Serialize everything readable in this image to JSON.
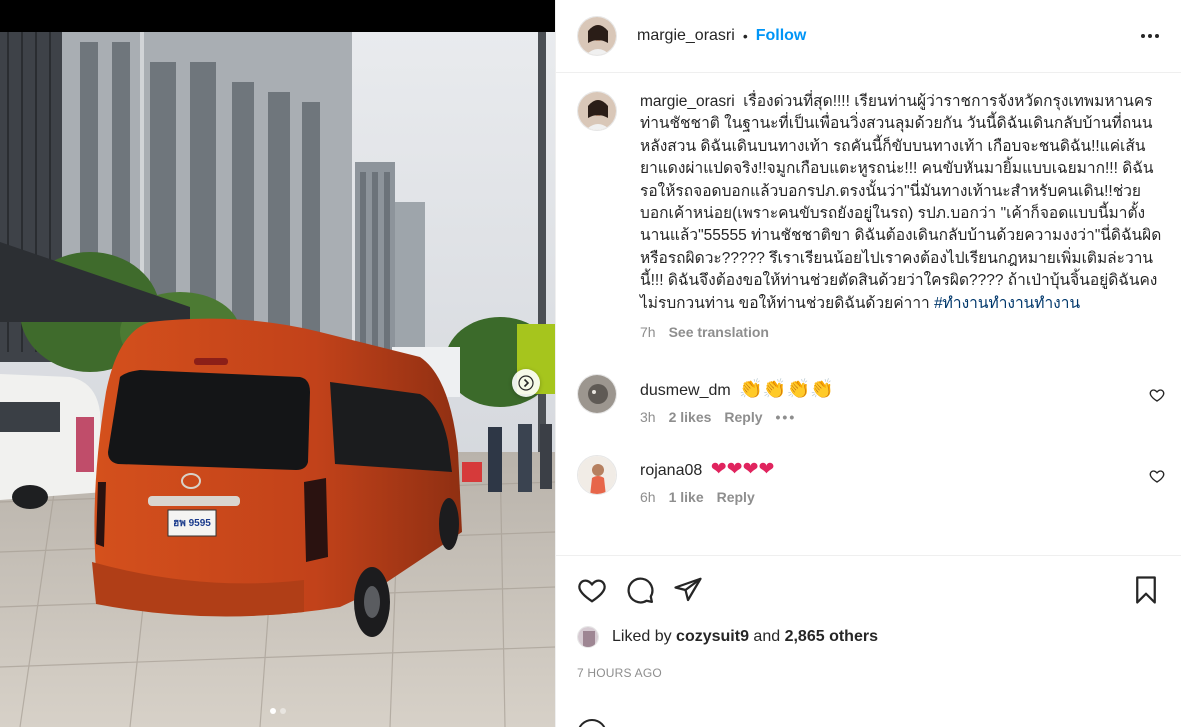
{
  "post": {
    "username": "margie_orasri",
    "separator": "•",
    "follow_label": "Follow",
    "caption": {
      "username": "margie_orasri",
      "text": "เรื่องด่วนที่สุด!!!! เรียนท่านผู้ว่าราชการจังหวัดกรุงเทพมหานคร ท่านชัชชาติ ในฐานะที่เป็นเพื่อนวิ่งสวนลุมด้วยกัน วันนี้ดิฉันเดินกลับบ้านที่ถนนหลังสวน ดิฉันเดินบนทางเท้า รถคันนี้ก็ขับบนทางเท้า เกือบจะชนดิฉัน!!แค่เส้นยาแดงผ่าแปดจริง!!จมูกเกือบแตะหูรถน่ะ!!! คนขับหันมายิ้มแบบเฉยมาก!!! ดิฉันรอให้รถจอดบอกแล้วบอกรปภ.ตรงนั้นว่า\"นี่มันทางเท้านะสำหรับคนเดิน!!ช่วยบอกเค้าหน่อย(เพราะคนขับรถยังอยู่ในรถ) รปภ.บอกว่า \"เค้าก็จอดแบบนี้มาตั้งนานแล้ว\"55555 ท่านชัชชาติขา ดิฉันต้องเดินกลับบ้านด้วยความงงว่า\"นี่ดิฉันผิดหรือรถผิดวะ????? รึเราเรียนน้อยไปเราคงต้องไปเรียนกฎหมายเพิ่มเติมล่ะวานนี้!!! ดิฉันจึงต้องขอให้ท่านช่วยตัดสินด้วยว่าใครผิด???? ถ้าเป่าบุ้นจิ้นอยู่ดิฉันคงไม่รบกวนท่าน ขอให้ท่านช่วยดิฉันด้วยค่าาา",
      "hashtag": "#ทำงานทำงานทำงาน",
      "time": "7h",
      "translate_label": "See translation"
    },
    "comments": [
      {
        "username": "dusmew_dm",
        "emoji": "👏👏👏👏",
        "time": "3h",
        "likes": "2 likes",
        "reply_label": "Reply",
        "more": "•••"
      },
      {
        "username": "rojana08",
        "emoji": "❤❤❤❤",
        "time": "6h",
        "likes": "1 like",
        "reply_label": "Reply"
      }
    ],
    "liked_by_prefix": "Liked by",
    "liked_by_user": "cozysuit9",
    "liked_by_and": "and",
    "liked_by_others": "2,865 others",
    "time_ago": "7 HOURS AGO"
  },
  "media": {
    "slide_count": 2,
    "current_slide": 1,
    "plate_text": "ฮพ 9595"
  },
  "icons": {
    "next": "chevron-right-icon",
    "like": "heart-icon",
    "comment": "comment-icon",
    "share": "paper-plane-icon",
    "save": "bookmark-icon",
    "more": "more-horizontal-icon"
  },
  "colors": {
    "link": "#0095f6",
    "hashtag": "#00376b",
    "secondary_text": "#8e8e8e",
    "van": "#c8471a"
  }
}
